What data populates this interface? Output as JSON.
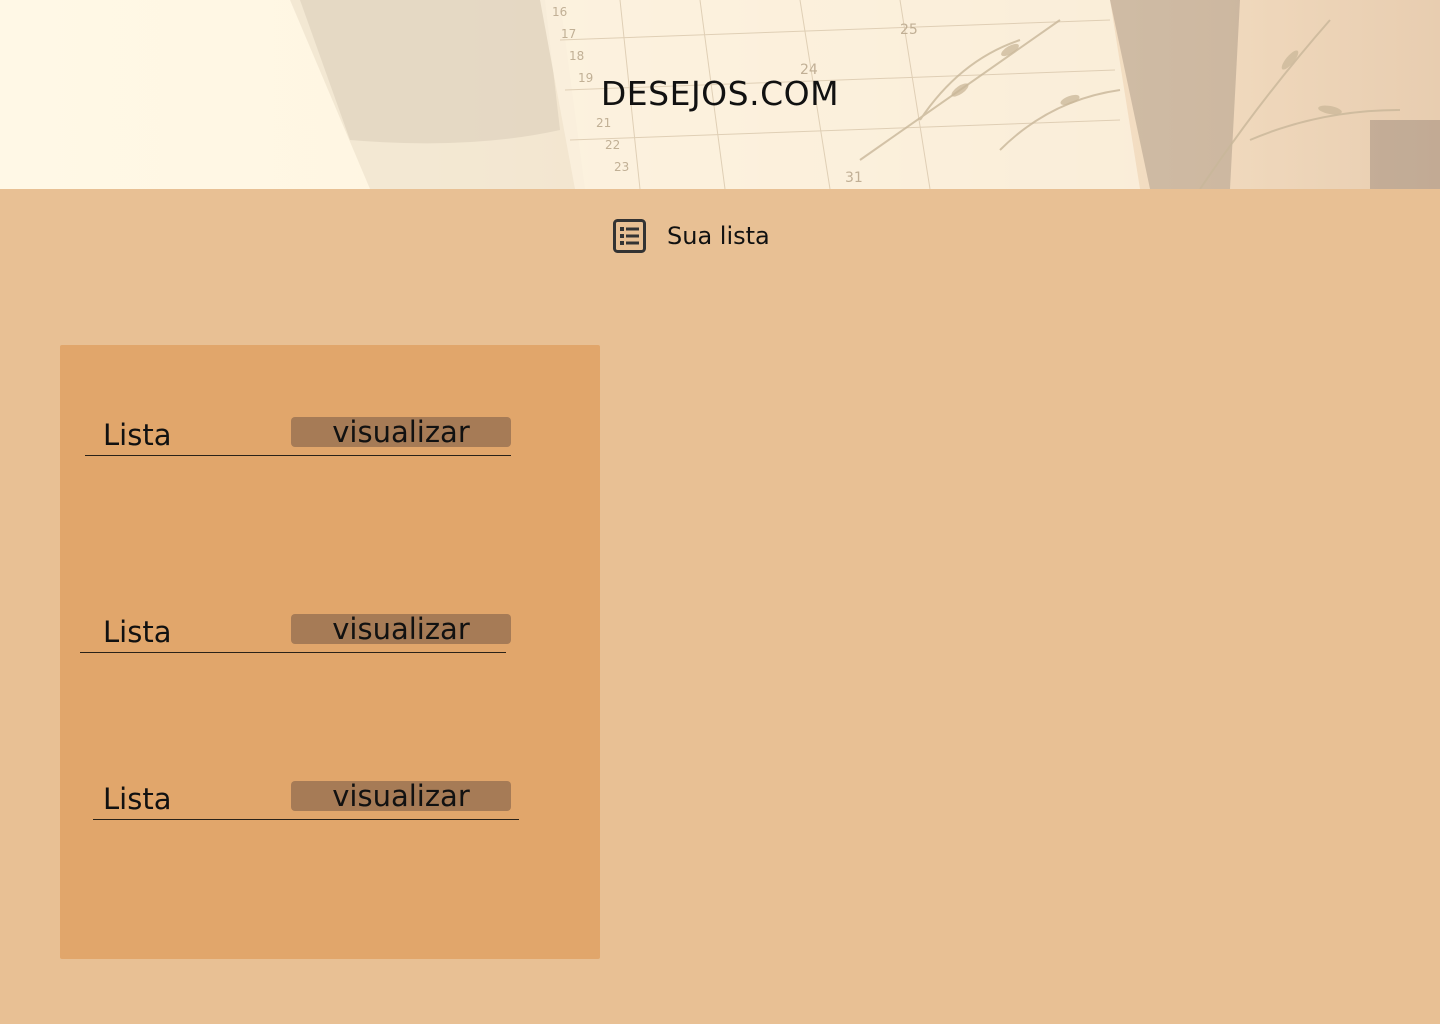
{
  "header": {
    "site_title": "DESEJOS.COM"
  },
  "subnav": {
    "icon": "list-icon",
    "label": "Sua lista"
  },
  "lists": [
    {
      "name": "Lista",
      "action_label": "visualizar"
    },
    {
      "name": "Lista",
      "action_label": "visualizar"
    },
    {
      "name": "Lista",
      "action_label": "visualizar"
    }
  ],
  "colors": {
    "page_background": "#e8c094",
    "panel_background": "#e1a66b",
    "button_background": "#a67b56",
    "header_background": "#fff8e6"
  }
}
